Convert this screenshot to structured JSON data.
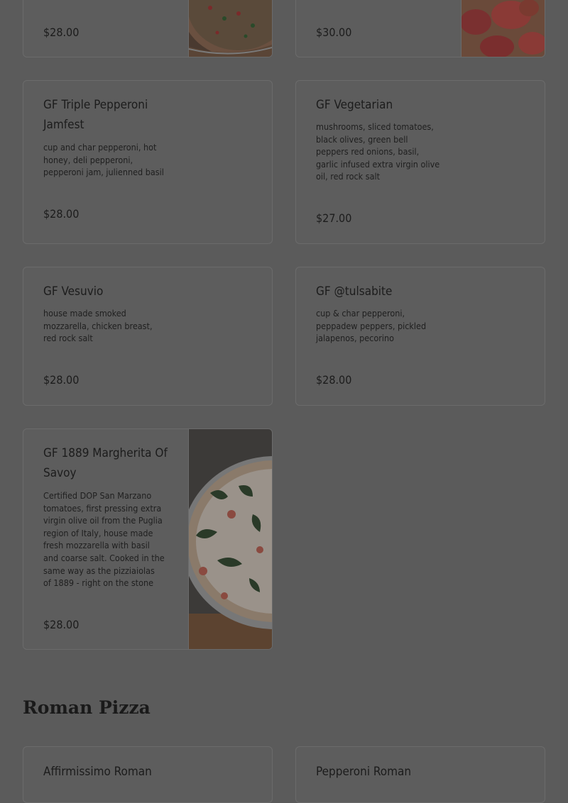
{
  "menu": {
    "top_row": [
      {
        "price": "$28.00"
      },
      {
        "price": "$30.00"
      }
    ],
    "items": [
      {
        "title": "GF Triple Pepperoni Jamfest",
        "title_line1": "GF Triple Pepperoni",
        "title_line2": "Jamfest",
        "desc_lines": [
          "cup and char pepperoni, hot",
          "honey, deli pepperoni,",
          "pepperoni jam, julienned basil"
        ],
        "price": "$28.00"
      },
      {
        "title": "GF Vegetarian",
        "desc_lines": [
          "mushrooms, sliced tomatoes,",
          "black olives, green bell",
          "peppers red onions, basil,",
          "garlic infused extra virgin olive",
          "oil, red rock salt"
        ],
        "price": "$27.00"
      },
      {
        "title": "GF Vesuvio",
        "desc_lines": [
          "house made smoked",
          "mozzarella, chicken breast,",
          "red rock salt"
        ],
        "price": "$28.00"
      },
      {
        "title": "GF @tulsabite",
        "desc_lines": [
          "cup & char pepperoni,",
          "peppadew peppers, pickled",
          "jalapenos, pecorino"
        ],
        "price": "$28.00"
      },
      {
        "title_line1": "GF 1889 Margherita Of",
        "title_line2": "Savoy",
        "desc_lines": [
          "Certified DOP San Marzano",
          "tomatoes, first pressing extra",
          "virgin olive oil from the Puglia",
          "region of Italy, house made",
          "fresh mozzarella with basil",
          "and coarse salt. Cooked in the",
          "same way as the pizziaiolas",
          "of 1889 - right on the stone"
        ],
        "price": "$28.00"
      }
    ]
  },
  "roman_section": {
    "title": "Roman Pizza",
    "items": [
      {
        "title": "Affirmissimo Roman"
      },
      {
        "title": "Pepperoni Roman"
      }
    ]
  },
  "icons": {
    "pizza_image": "pizza-photo",
    "pepperoni_image": "pepperoni-photo",
    "margherita_image": "margherita-photo"
  }
}
